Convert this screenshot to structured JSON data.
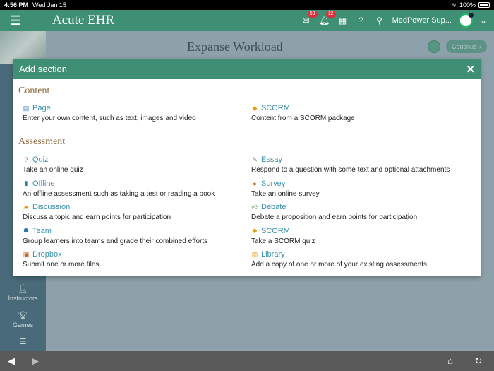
{
  "status": {
    "time": "4:56 PM",
    "date": "Wed Jan 15",
    "battery": "100%"
  },
  "app": {
    "title": "Acute EHR",
    "user": "MedPower Sup...",
    "badges": {
      "messages": "53",
      "notifications": "12"
    }
  },
  "page": {
    "heading": "Expanse Workload",
    "continue_label": "Continue"
  },
  "sidebar": {
    "items": [
      {
        "label": "Instructors"
      },
      {
        "label": "Games"
      }
    ]
  },
  "modal": {
    "title": "Add section",
    "content_title": "Content",
    "assessment_title": "Assessment",
    "content": [
      {
        "name": "Page",
        "desc": "Enter your own content, such as text, images and video",
        "icon": "page-icon",
        "color": "#2d7fb0"
      },
      {
        "name": "SCORM",
        "desc": "Content from a SCORM package",
        "icon": "scorm-icon",
        "color": "#e0a010"
      }
    ],
    "assessment_left": [
      {
        "name": "Quiz",
        "desc": "Take an online quiz",
        "icon": "quiz-icon",
        "color": "#c8641e"
      },
      {
        "name": "Offline",
        "desc": "An offline assessment such as taking a test or reading a book",
        "icon": "book-icon",
        "color": "#2d7fb0"
      },
      {
        "name": "Discussion",
        "desc": "Discuss a topic and earn points for participation",
        "icon": "chat-icon",
        "color": "#e0a010"
      },
      {
        "name": "Team",
        "desc": "Group learners into teams and grade their combined efforts",
        "icon": "team-icon",
        "color": "#2d7fb0"
      },
      {
        "name": "Dropbox",
        "desc": "Submit one or more files",
        "icon": "dropbox-icon",
        "color": "#c8641e"
      }
    ],
    "assessment_right": [
      {
        "name": "Essay",
        "desc": "Respond to a question with some text and optional attachments",
        "icon": "pen-icon",
        "color": "#4a9a3a"
      },
      {
        "name": "Survey",
        "desc": "Take an online survey",
        "icon": "survey-icon",
        "color": "#c8641e"
      },
      {
        "name": "Debate",
        "desc": "Debate a proposition and earn points for participation",
        "icon": "thumb-icon",
        "color": "#4a9a3a"
      },
      {
        "name": "SCORM",
        "desc": "Take a SCORM quiz",
        "icon": "scorm-icon",
        "color": "#e0a010"
      },
      {
        "name": "Library",
        "desc": "Add a copy of one or more of your existing assessments",
        "icon": "library-icon",
        "color": "#e0a010"
      }
    ]
  }
}
